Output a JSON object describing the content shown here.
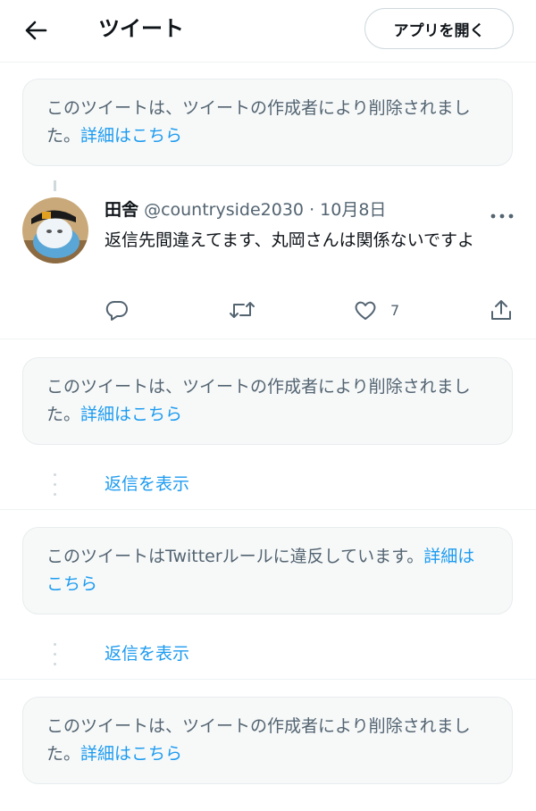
{
  "header": {
    "title": "ツイート",
    "open_app_label": "アプリを開く",
    "back_icon": "arrow-left-icon"
  },
  "notices": [
    {
      "text": "このツイートは、ツイートの作成者により削除されました。",
      "link": "詳細はこちら"
    },
    {
      "text": "このツイートは、ツイートの作成者により削除されました。",
      "link": "詳細はこちら"
    },
    {
      "text": "このツイートはTwitterルールに違反しています。",
      "link": "詳細はこちら"
    },
    {
      "text": "このツイートは、ツイートの作成者により削除されました。",
      "link": "詳細はこちら"
    }
  ],
  "tweet": {
    "name": "田舎",
    "handle": "@countryside2030",
    "separator": "·",
    "date": "10月8日",
    "text": "返信先間違えてます、丸岡さんは関係ないですよ",
    "actions": {
      "reply_icon": "reply-icon",
      "retweet_icon": "retweet-icon",
      "like_icon": "heart-icon",
      "like_count": "7",
      "share_icon": "share-icon"
    }
  },
  "show_replies": [
    "返信を表示",
    "返信を表示"
  ],
  "colors": {
    "accent": "#1d9bf0",
    "text_primary": "#0f1419",
    "text_secondary": "#536471",
    "notice_bg": "#f7f9f9"
  }
}
